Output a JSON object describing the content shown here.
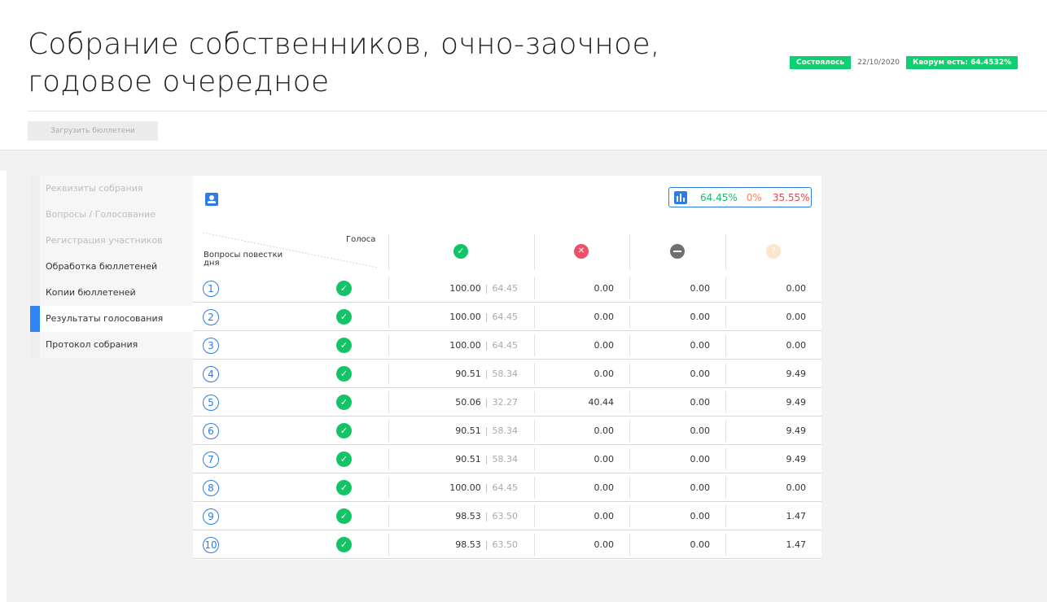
{
  "meeting": {
    "title": "Собрание собственников, очно-заочное, годовое очередное",
    "status": "Состоялось",
    "date": "22/10/2020",
    "quorum": "Кворум есть: 64.4532%"
  },
  "actions": {
    "upload_label": "Загрузить бюллетени"
  },
  "sidebar": {
    "items": [
      {
        "label": "Реквизиты собрания",
        "state": "disabled"
      },
      {
        "label": "Вопросы / Голосование",
        "state": "disabled"
      },
      {
        "label": "Регистрация участников",
        "state": "disabled"
      },
      {
        "label": "Обработка бюллетеней",
        "state": "normal"
      },
      {
        "label": "Копии бюллетеней",
        "state": "normal"
      },
      {
        "label": "Результаты голосования",
        "state": "active"
      },
      {
        "label": "Протокол собрания",
        "state": "normal"
      }
    ]
  },
  "summary": {
    "yes": "64.45%",
    "no": "0%",
    "absent": "35.55%"
  },
  "table": {
    "header_votes": "Голоса",
    "header_questions": "Вопросы повестки дня",
    "rows": [
      {
        "num": "1",
        "yes": "100.00",
        "yes_share": "64.45",
        "no": "0.00",
        "abstain": "0.00",
        "not_voted": "0.00"
      },
      {
        "num": "2",
        "yes": "100.00",
        "yes_share": "64.45",
        "no": "0.00",
        "abstain": "0.00",
        "not_voted": "0.00"
      },
      {
        "num": "3",
        "yes": "100.00",
        "yes_share": "64.45",
        "no": "0.00",
        "abstain": "0.00",
        "not_voted": "0.00"
      },
      {
        "num": "4",
        "yes": "90.51",
        "yes_share": "58.34",
        "no": "0.00",
        "abstain": "0.00",
        "not_voted": "9.49"
      },
      {
        "num": "5",
        "yes": "50.06",
        "yes_share": "32.27",
        "no": "40.44",
        "abstain": "0.00",
        "not_voted": "9.49"
      },
      {
        "num": "6",
        "yes": "90.51",
        "yes_share": "58.34",
        "no": "0.00",
        "abstain": "0.00",
        "not_voted": "9.49"
      },
      {
        "num": "7",
        "yes": "90.51",
        "yes_share": "58.34",
        "no": "0.00",
        "abstain": "0.00",
        "not_voted": "9.49"
      },
      {
        "num": "8",
        "yes": "100.00",
        "yes_share": "64.45",
        "no": "0.00",
        "abstain": "0.00",
        "not_voted": "0.00"
      },
      {
        "num": "9",
        "yes": "98.53",
        "yes_share": "63.50",
        "no": "0.00",
        "abstain": "0.00",
        "not_voted": "1.47"
      },
      {
        "num": "10",
        "yes": "98.53",
        "yes_share": "63.50",
        "no": "0.00",
        "abstain": "0.00",
        "not_voted": "1.47"
      }
    ]
  },
  "icons": {
    "user": "user-card-icon",
    "chart": "bar-chart-icon",
    "yes": "check-circle-icon",
    "no": "cross-circle-icon",
    "abstain": "minus-circle-icon",
    "not_voted": "question-circle-icon"
  },
  "colors": {
    "accent": "#2e7be8",
    "success": "#13c466",
    "danger": "#ee5067",
    "neutral": "#6f6f6f",
    "pending": "#fde5cc"
  }
}
